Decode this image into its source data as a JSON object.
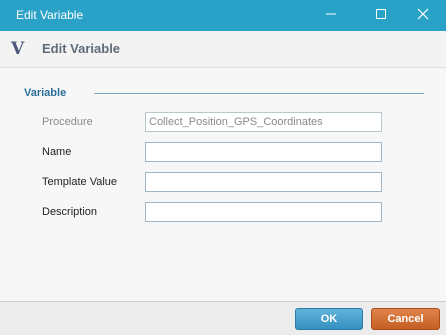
{
  "window": {
    "title": "Edit Variable",
    "minimize_icon": "minimize-icon",
    "maximize_icon": "maximize-icon",
    "close_icon": "close-icon"
  },
  "header": {
    "logo": "V",
    "title": "Edit Variable"
  },
  "section": {
    "label": "Variable"
  },
  "fields": [
    {
      "label": "Procedure",
      "value": "Collect_Position_GPS_Coordinates",
      "disabled": true
    },
    {
      "label": "Name",
      "value": ""
    },
    {
      "label": "Template Value",
      "value": ""
    },
    {
      "label": "Description",
      "value": ""
    }
  ],
  "footer": {
    "ok_label": "OK",
    "cancel_label": "Cancel"
  },
  "colors": {
    "titlebar": "#2aa2c8",
    "ok_button": "#3591c0",
    "cancel_button": "#c45f24",
    "section_label": "#2e6f98"
  }
}
